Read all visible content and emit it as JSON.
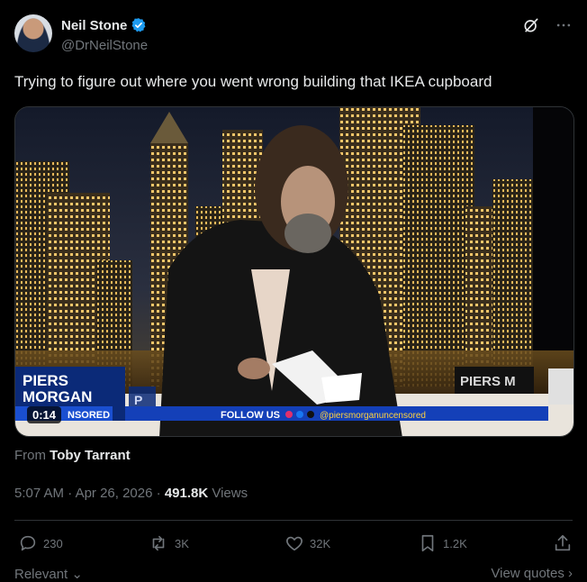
{
  "author": {
    "display_name": "Neil Stone",
    "handle": "@DrNeilStone"
  },
  "tweet": {
    "text": "Trying to figure out where you went wrong building that IKEA cupboard",
    "from_prefix": "From",
    "from_name": "Toby Tarrant",
    "time": "5:07 AM",
    "date": "Apr 26, 2026",
    "separator": "·",
    "views_count": "491.8K",
    "views_label": "Views"
  },
  "video": {
    "duration": "0:14",
    "overlay": {
      "show_name_line1": "PIERS",
      "show_name_line2": "MORGAN",
      "show_name_line3": "NSORED",
      "lower_bar": "FOLLOW US",
      "handle": "@piersmorganuncensored",
      "right_sign": "PIERS M",
      "mid_sign": "P"
    }
  },
  "actions": {
    "replies": "230",
    "reposts": "3K",
    "likes": "32K",
    "bookmarks": "1.2K"
  },
  "footer": {
    "sort_label": "Relevant",
    "view_quotes": "View quotes"
  },
  "colors": {
    "background": "#000000",
    "text_primary": "#e7e9ea",
    "text_secondary": "#71767b",
    "verified": "#1d9bf0",
    "divider": "#2f3336"
  }
}
